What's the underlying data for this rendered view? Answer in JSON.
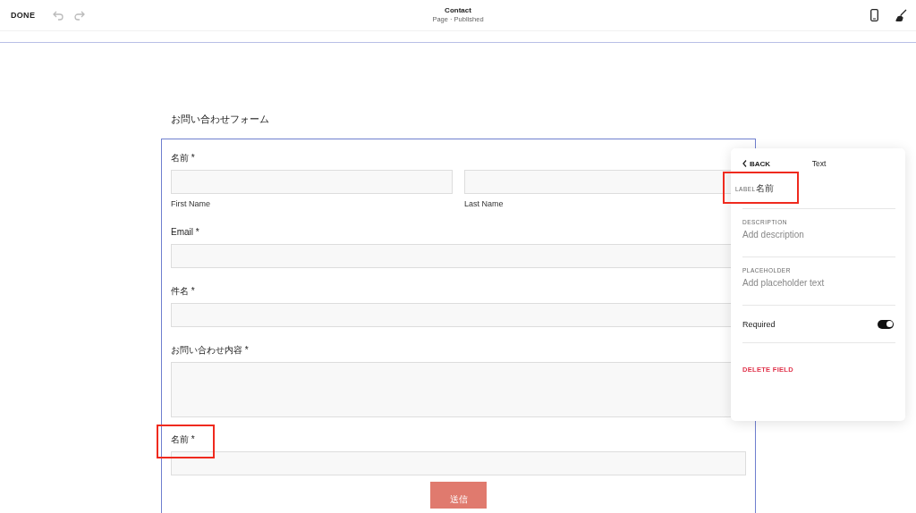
{
  "topbar": {
    "done": "DONE",
    "title": "Contact",
    "subtitle": "Page · Published"
  },
  "form": {
    "heading": "お問い合わせフォーム",
    "fields": [
      {
        "kind": "name",
        "label": "名前 *",
        "sublabels": [
          "First Name",
          "Last Name"
        ],
        "highlighted": false
      },
      {
        "kind": "text",
        "label": "Email *",
        "highlighted": false
      },
      {
        "kind": "text",
        "label": "件名 *",
        "highlighted": false
      },
      {
        "kind": "textarea",
        "label": "お問い合わせ内容 *",
        "highlighted": false
      },
      {
        "kind": "text",
        "label": "名前 *",
        "highlighted": true
      }
    ],
    "submit": "送信"
  },
  "panel": {
    "back": "BACK",
    "title": "Text",
    "sections": [
      {
        "kind": "field",
        "label": "LABEL",
        "value": "名前",
        "highlighted": true
      },
      {
        "kind": "field",
        "label": "DESCRIPTION",
        "placeholder": "Add description",
        "highlighted": false
      },
      {
        "kind": "field",
        "label": "PLACEHOLDER",
        "placeholder": "Add placeholder text",
        "highlighted": false
      },
      {
        "kind": "toggle",
        "label": "Required",
        "on": true
      }
    ],
    "delete": "DELETE FIELD"
  }
}
